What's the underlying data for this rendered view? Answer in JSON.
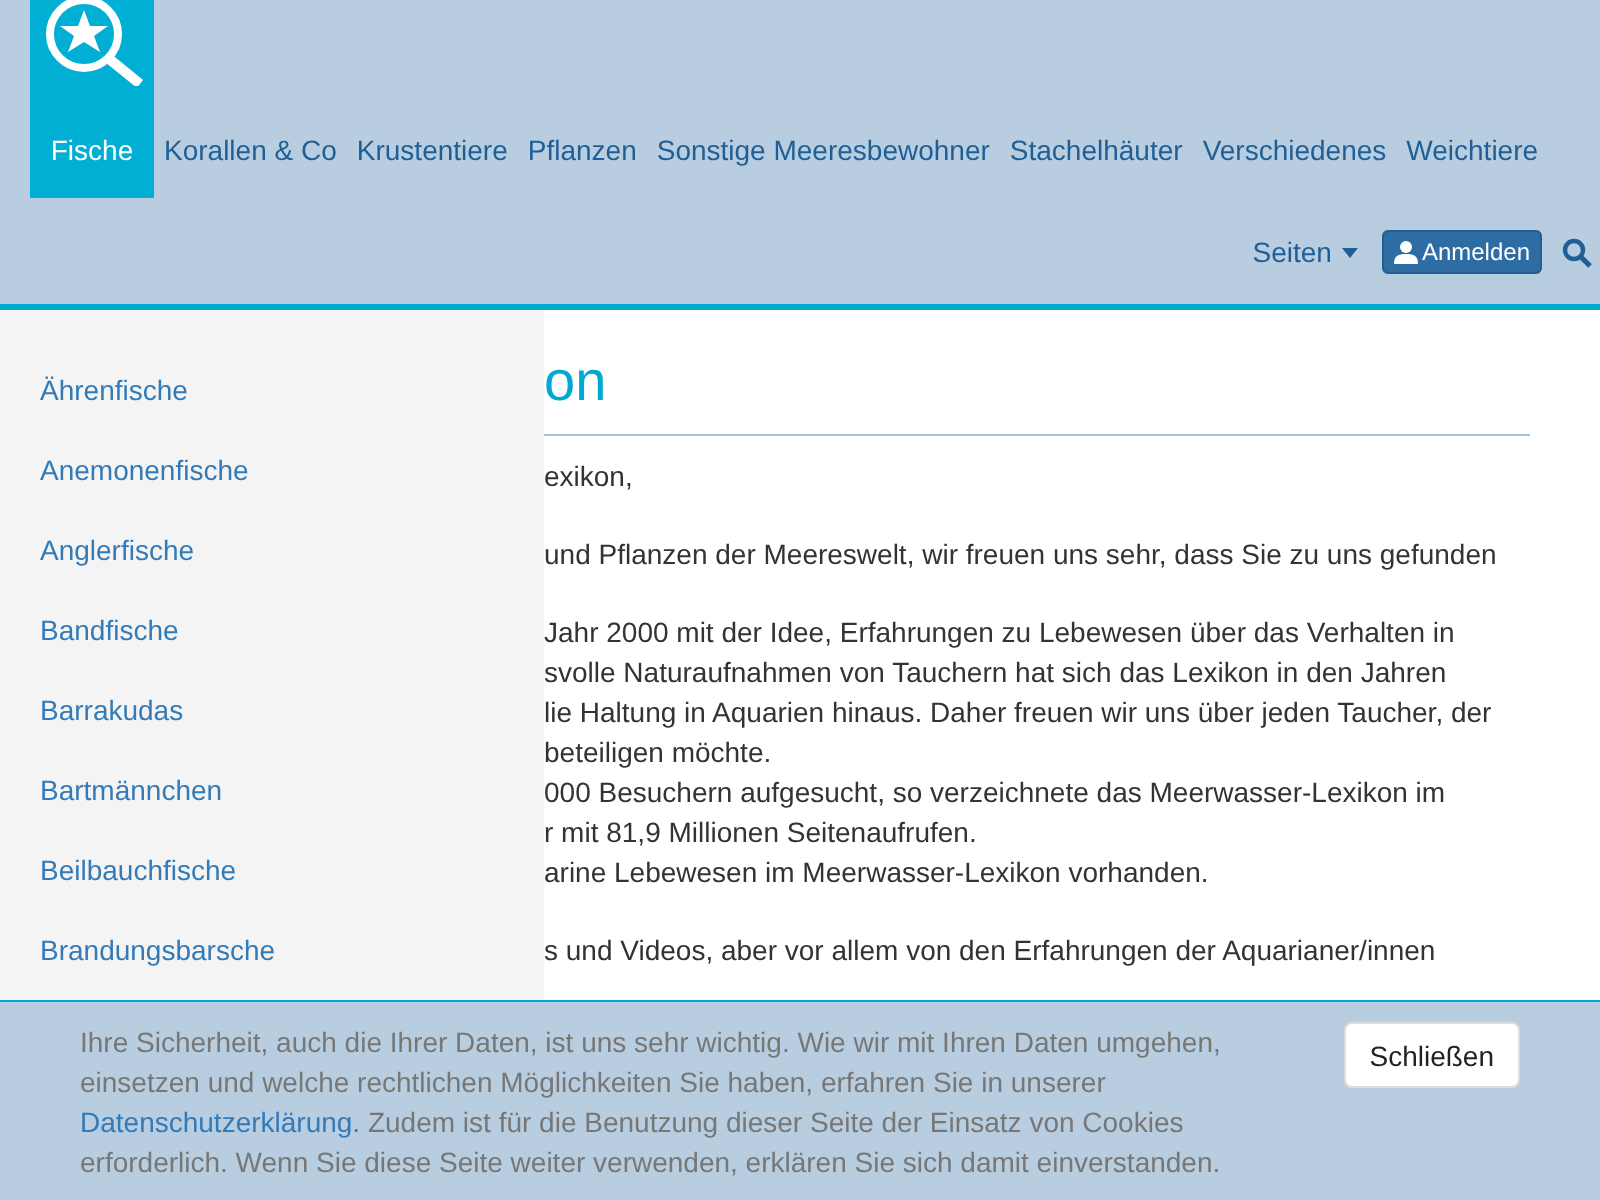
{
  "nav": {
    "items": [
      {
        "label": "Fische",
        "selected": true
      },
      {
        "label": "Korallen & Co",
        "selected": false
      },
      {
        "label": "Krustentiere",
        "selected": false
      },
      {
        "label": "Pflanzen",
        "selected": false
      },
      {
        "label": "Sonstige Meeresbewohner",
        "selected": false
      },
      {
        "label": "Stachelhäuter",
        "selected": false
      },
      {
        "label": "Verschiedenes",
        "selected": false
      },
      {
        "label": "Weichtiere",
        "selected": false
      }
    ],
    "pages_menu": "Seiten",
    "login_button": "Anmelden"
  },
  "sidebar": {
    "items": [
      "Ährenfische",
      "Anemonenfische",
      "Anglerfische",
      "Bandfische",
      "Barrakudas",
      "Bartmännchen",
      "Beilbauchfische",
      "Brandungsbarsche"
    ]
  },
  "content": {
    "heading": "on",
    "paragraphs": [
      [
        "exikon,"
      ],
      [
        "und Pflanzen der Meereswelt, wir freuen uns sehr, dass Sie zu uns gefunden"
      ],
      [
        "Jahr 2000 mit der Idee, Erfahrungen zu Lebewesen über das Verhalten in",
        "svolle Naturaufnahmen von Tauchern hat sich das Lexikon in den Jahren",
        "lie Haltung in Aquarien hinaus. Daher freuen wir uns über jeden Taucher, der",
        "beteiligen möchte.",
        "000 Besuchern aufgesucht, so verzeichnete das Meerwasser-Lexikon im",
        "r mit 81,9 Millionen Seitenaufrufen.",
        "arine Lebewesen im Meerwasser-Lexikon vorhanden."
      ],
      [
        "s und Videos, aber vor allem von den Erfahrungen der Aquarianer/innen"
      ]
    ]
  },
  "cookie_banner": {
    "text_before": "Ihre Sicherheit, auch die Ihrer Daten, ist uns sehr wichtig. Wie wir mit Ihren Daten umgehen, einsetzen und welche rechtlichen Möglichkeiten Sie haben, erfahren Sie in unserer",
    "link": "Datenschutzerklärung.",
    "text_after": "Zudem ist für die Benutzung dieser Seite der Einsatz von Cookies erforderlich. Wenn Sie diese Seite weiter verwenden, erklären Sie sich damit einverstanden.",
    "close_button": "Schließen"
  }
}
